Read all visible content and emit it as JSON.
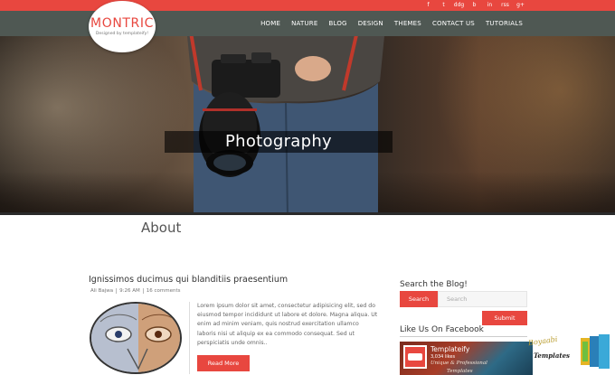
{
  "social": [
    "f",
    "t",
    "ddg",
    "b",
    "in",
    "rss",
    "g+"
  ],
  "brand": {
    "title": "MONTRIC",
    "subtitle": "Designed by templateify!"
  },
  "nav": [
    "HOME",
    "NATURE",
    "BLOG",
    "DESIGN",
    "THEMES",
    "CONTACT US",
    "TUTORIALS"
  ],
  "hero": {
    "caption": "Photography"
  },
  "page": {
    "title": "About"
  },
  "post": {
    "title": "Ignissimos ducimus qui blanditiis praesentium",
    "author": "Ali Bajwa",
    "time": "9:26 AM",
    "comments": "16 comments",
    "excerpt": "Lorem ipsum dolor sit amet, consectetur adipisicing elit, sed do eiusmod tempor incididunt ut labore et dolore. Magna aliqua. Ut enim ad minim veniam, quis nostrud exercitation ullamco laboris nisi ut aliquip ex ea commodo consequat. Sed ut perspiciatis unde omnis..",
    "read_more": "Read More"
  },
  "sidebar": {
    "search_title": "Search the Blog!",
    "search_label": "Search",
    "search_placeholder": "Search",
    "submit": "Submit",
    "facebook_title": "Like Us On Facebook",
    "facebook": {
      "name": "Templateify",
      "likes": "3,034 likes",
      "tagline1": "Unique & Professional",
      "tagline2": "Templates"
    }
  },
  "watermark": {
    "line1": "Boyaabi",
    "line2": "Templates"
  },
  "colors": {
    "accent": "#e8473f",
    "nav": "#4f5853"
  }
}
